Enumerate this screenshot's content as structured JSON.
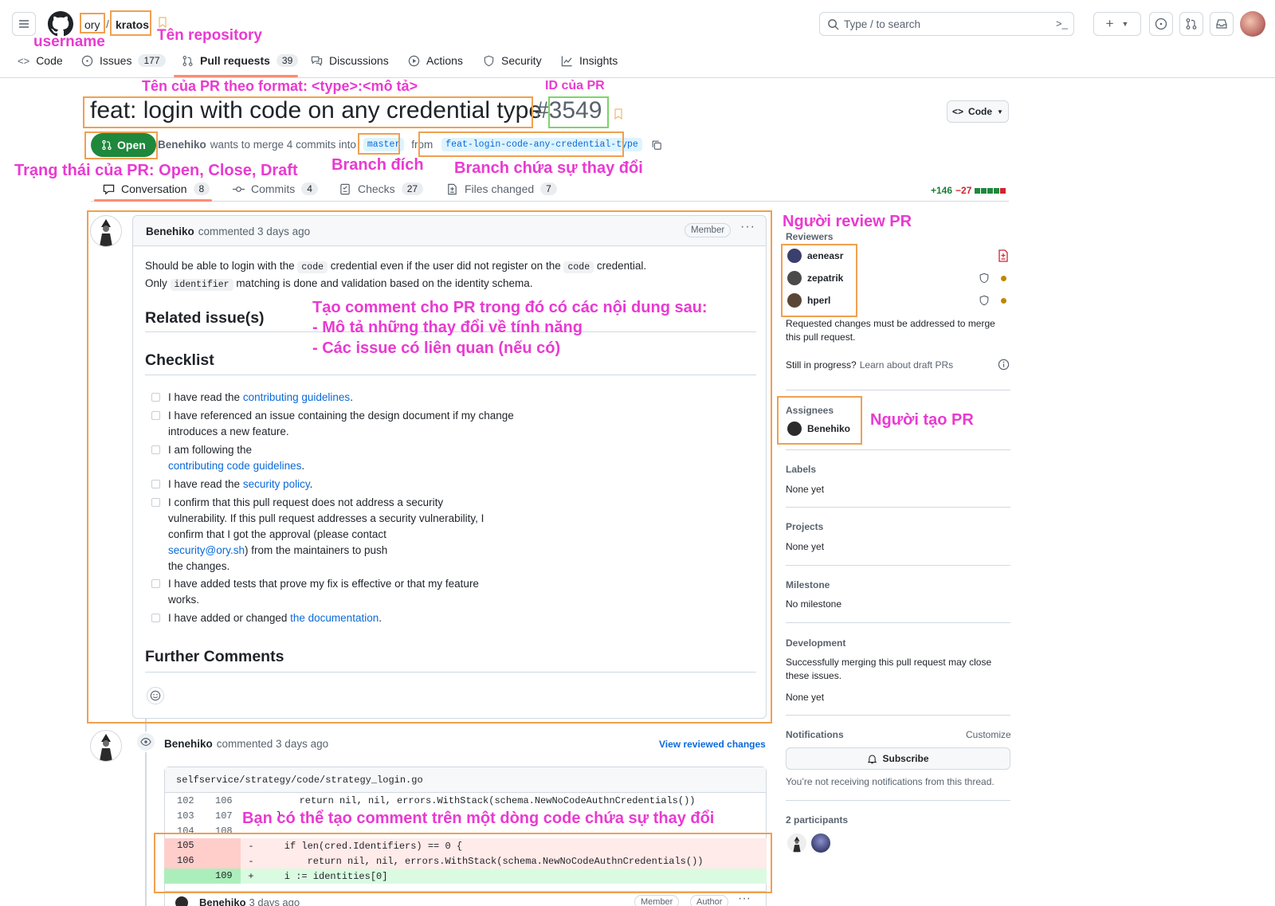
{
  "header": {
    "owner": "ory",
    "repo": "kratos",
    "search_placeholder": "Type / to search",
    "nav": [
      {
        "label": "Code"
      },
      {
        "label": "Issues",
        "count": "177"
      },
      {
        "label": "Pull requests",
        "count": "39"
      },
      {
        "label": "Discussions"
      },
      {
        "label": "Actions"
      },
      {
        "label": "Security"
      },
      {
        "label": "Insights"
      }
    ]
  },
  "pr": {
    "title": "feat: login with code on any credential type",
    "number": "#3549",
    "code_button": "Code",
    "state": "Open",
    "author": "Benehiko",
    "merge_text": "wants to merge 4 commits into",
    "base_branch": "master",
    "from_text": "from",
    "head_branch": "feat-login-code-any-credential-type",
    "additions": "+146",
    "deletions": "−27"
  },
  "tabs": [
    {
      "label": "Conversation",
      "count": "8"
    },
    {
      "label": "Commits",
      "count": "4"
    },
    {
      "label": "Checks",
      "count": "27"
    },
    {
      "label": "Files changed",
      "count": "7"
    }
  ],
  "comment": {
    "author": "Benehiko",
    "meta": "commented 3 days ago",
    "badge": "Member",
    "intro_1a": "Should be able to login with the",
    "intro_code1": "code",
    "intro_1b": "credential even if the user did not register on the",
    "intro_code2": "code",
    "intro_1c": "credential.",
    "intro_2a": "Only",
    "intro_code3": "identifier",
    "intro_2b": "matching is done and validation based on the identity schema.",
    "related_heading": "Related issue(s)",
    "checklist_heading": "Checklist",
    "further_heading": "Further Comments",
    "checklist": {
      "c1a": "I have read the",
      "c1link": "contributing guidelines",
      "c1b": ".",
      "c2a": "I have referenced an issue containing the design document if my change",
      "c2b": "introduces a new feature.",
      "c3a": "I am following the",
      "c3link": "contributing code guidelines",
      "c3b": ".",
      "c4a": "I have read the",
      "c4link": "security policy",
      "c4b": ".",
      "c5a": "I confirm that this pull request does not address a security",
      "c5b": "vulnerability. If this pull request addresses a security vulnerability, I",
      "c5c": "confirm that I got the approval (please contact",
      "c5link": "security@ory.sh",
      "c5d": ") from the maintainers to push",
      "c5e": "the changes.",
      "c6a": "I have added tests that prove my fix is effective or that my feature",
      "c6b": "works.",
      "c7a": "I have added or changed",
      "c7link": "the documentation",
      "c7b": "."
    }
  },
  "review": {
    "author": "Benehiko",
    "meta": "commented 3 days ago",
    "view_changes": "View reviewed changes",
    "file": "selfservice/strategy/code/strategy_login.go",
    "lines": [
      {
        "old": "102",
        "new": "106",
        "sign": "",
        "code": "        return nil, nil, errors.WithStack(schema.NewNoCodeAuthnCredentials())",
        "type": "ctx"
      },
      {
        "old": "103",
        "new": "107",
        "sign": "",
        "code": "    }",
        "type": "ctx"
      },
      {
        "old": "104",
        "new": "108",
        "sign": "",
        "code": "",
        "type": "ctx"
      },
      {
        "old": "105",
        "new": "",
        "sign": "-",
        "code": "    if len(cred.Identifiers) == 0 {",
        "type": "del"
      },
      {
        "old": "106",
        "new": "",
        "sign": "-",
        "code": "        return nil, nil, errors.WithStack(schema.NewNoCodeAuthnCredentials())",
        "type": "del"
      },
      {
        "old": "",
        "new": "109",
        "sign": "+",
        "code": "    i := identities[0]",
        "type": "add"
      }
    ],
    "reply_author": "Benehiko",
    "reply_meta": "3 days ago",
    "reply_badge_1": "Member",
    "reply_badge_2": "Author"
  },
  "sidebar": {
    "reviewers_heading": "Reviewers",
    "reviewers": [
      {
        "name": "aeneasr",
        "color": "#3b3f6e"
      },
      {
        "name": "zepatrik",
        "color": "#4a4a4a"
      },
      {
        "name": "hperl",
        "color": "#5a4636"
      }
    ],
    "changes_note": "Requested changes must be addressed to merge this pull request.",
    "draft_q": "Still in progress?",
    "draft_link": "Learn about draft PRs",
    "assignees_heading": "Assignees",
    "assignee": "Benehiko",
    "labels_heading": "Labels",
    "labels_value": "None yet",
    "projects_heading": "Projects",
    "projects_value": "None yet",
    "milestone_heading": "Milestone",
    "milestone_value": "No milestone",
    "development_heading": "Development",
    "development_note": "Successfully merging this pull request may close these issues.",
    "development_value": "None yet",
    "notifications_heading": "Notifications",
    "customize": "Customize",
    "subscribe": "Subscribe",
    "notif_note": "You’re not receiving notifications from this thread.",
    "participants": "2 participants"
  },
  "annotations": {
    "username": "username",
    "repo_name": "Tên repository",
    "pr_title_format": "Tên của PR theo format: <type>:<mô tả>",
    "pr_id": "ID của PR",
    "pr_state": "Trạng thái của PR: Open, Close, Draft",
    "target_branch": "Branch đích",
    "source_branch": "Branch chứa sự thay đổi",
    "reviewer": "Người review PR",
    "creator": "Người tạo PR",
    "comment_1": "Tạo comment cho PR trong đó có các nội dung sau:",
    "comment_2": "- Mô tả những thay đổi về tính năng",
    "comment_3": "- Các issue có liên quan (nếu có)",
    "line_comment": "Bạn có thể tạo comment trên một dòng code chứa sự thay đổi"
  },
  "colors": {
    "accent": "#0969da",
    "open": "#1f883d",
    "annotation": "#e93ad1",
    "box": "#f0a050"
  }
}
